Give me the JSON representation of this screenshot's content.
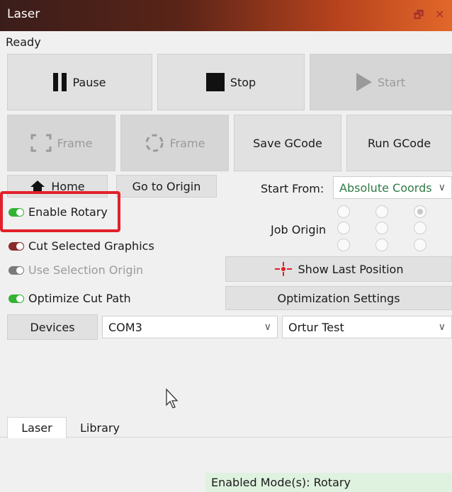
{
  "window": {
    "title": "Laser",
    "restore_glyph": "🗗",
    "close_glyph": "×"
  },
  "status": "Ready",
  "buttons": {
    "pause": "Pause",
    "stop": "Stop",
    "start": "Start",
    "frame_rect": "Frame",
    "frame_circle": "Frame",
    "save_gcode": "Save GCode",
    "run_gcode": "Run GCode",
    "home": "Home",
    "go_to_origin": "Go to Origin",
    "show_last_position": "Show Last Position",
    "optimization_settings": "Optimization Settings",
    "devices": "Devices"
  },
  "start_from": {
    "label": "Start From:",
    "value": "Absolute Coords"
  },
  "job_origin": {
    "label": "Job Origin",
    "selected_index": 2
  },
  "toggles": [
    {
      "label": "Enable Rotary",
      "state": "on"
    },
    {
      "label": "Cut Selected Graphics",
      "state": "off"
    },
    {
      "label": "Use Selection Origin",
      "state": "disabled"
    },
    {
      "label": "Optimize Cut Path",
      "state": "on"
    }
  ],
  "port_select": {
    "value": "COM3"
  },
  "device_select": {
    "value": "Ortur Test"
  },
  "tabs": [
    {
      "label": "Laser",
      "active": true
    },
    {
      "label": "Library",
      "active": false
    }
  ],
  "bottom_status": "Enabled Mode(s): Rotary",
  "colors": {
    "toggle_on": "#33b233",
    "toggle_off": "#8b2a2a",
    "highlight": "#e2202a",
    "status_bg": "#dff2df"
  }
}
